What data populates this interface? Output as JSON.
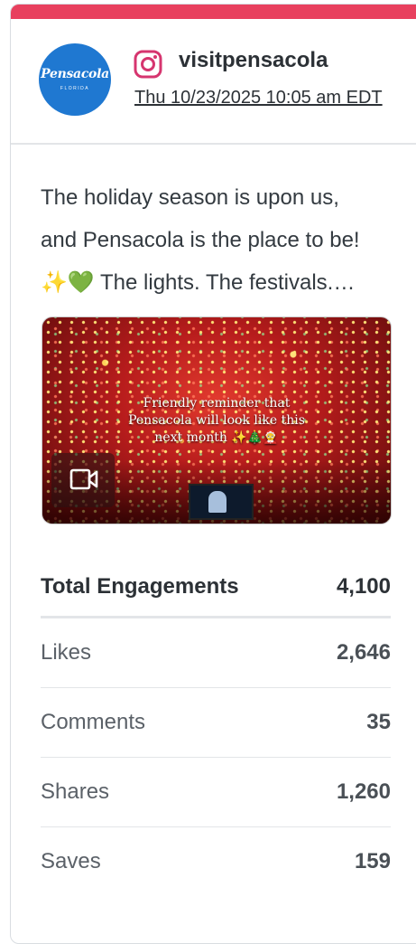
{
  "theme": {
    "accent": "#e8405e",
    "avatar_bg": "#1f78d1",
    "instagram_brand": "#d6356f"
  },
  "profile": {
    "avatar_logo": "Pensacola",
    "avatar_sub": "FLORIDA",
    "platform_icon": "instagram-icon",
    "account_name": "visitpensacola",
    "timestamp": "Thu 10/23/2025 10:05 am EDT"
  },
  "post": {
    "caption_lines": [
      "The holiday season is upon us,",
      "and Pensacola is the place to be!",
      "✨💚 The lights. The festivals.…"
    ],
    "media": {
      "type_icon": "video-camera-icon",
      "overlay_lines": [
        "Friendly reminder that",
        "Pensacola will look like this",
        "next month ✨🎄🤶"
      ]
    }
  },
  "metrics": {
    "total": {
      "label": "Total Engagements",
      "value": "4,100"
    },
    "items": [
      {
        "label": "Likes",
        "value": "2,646"
      },
      {
        "label": "Comments",
        "value": "35"
      },
      {
        "label": "Shares",
        "value": "1,260"
      },
      {
        "label": "Saves",
        "value": "159"
      }
    ]
  }
}
